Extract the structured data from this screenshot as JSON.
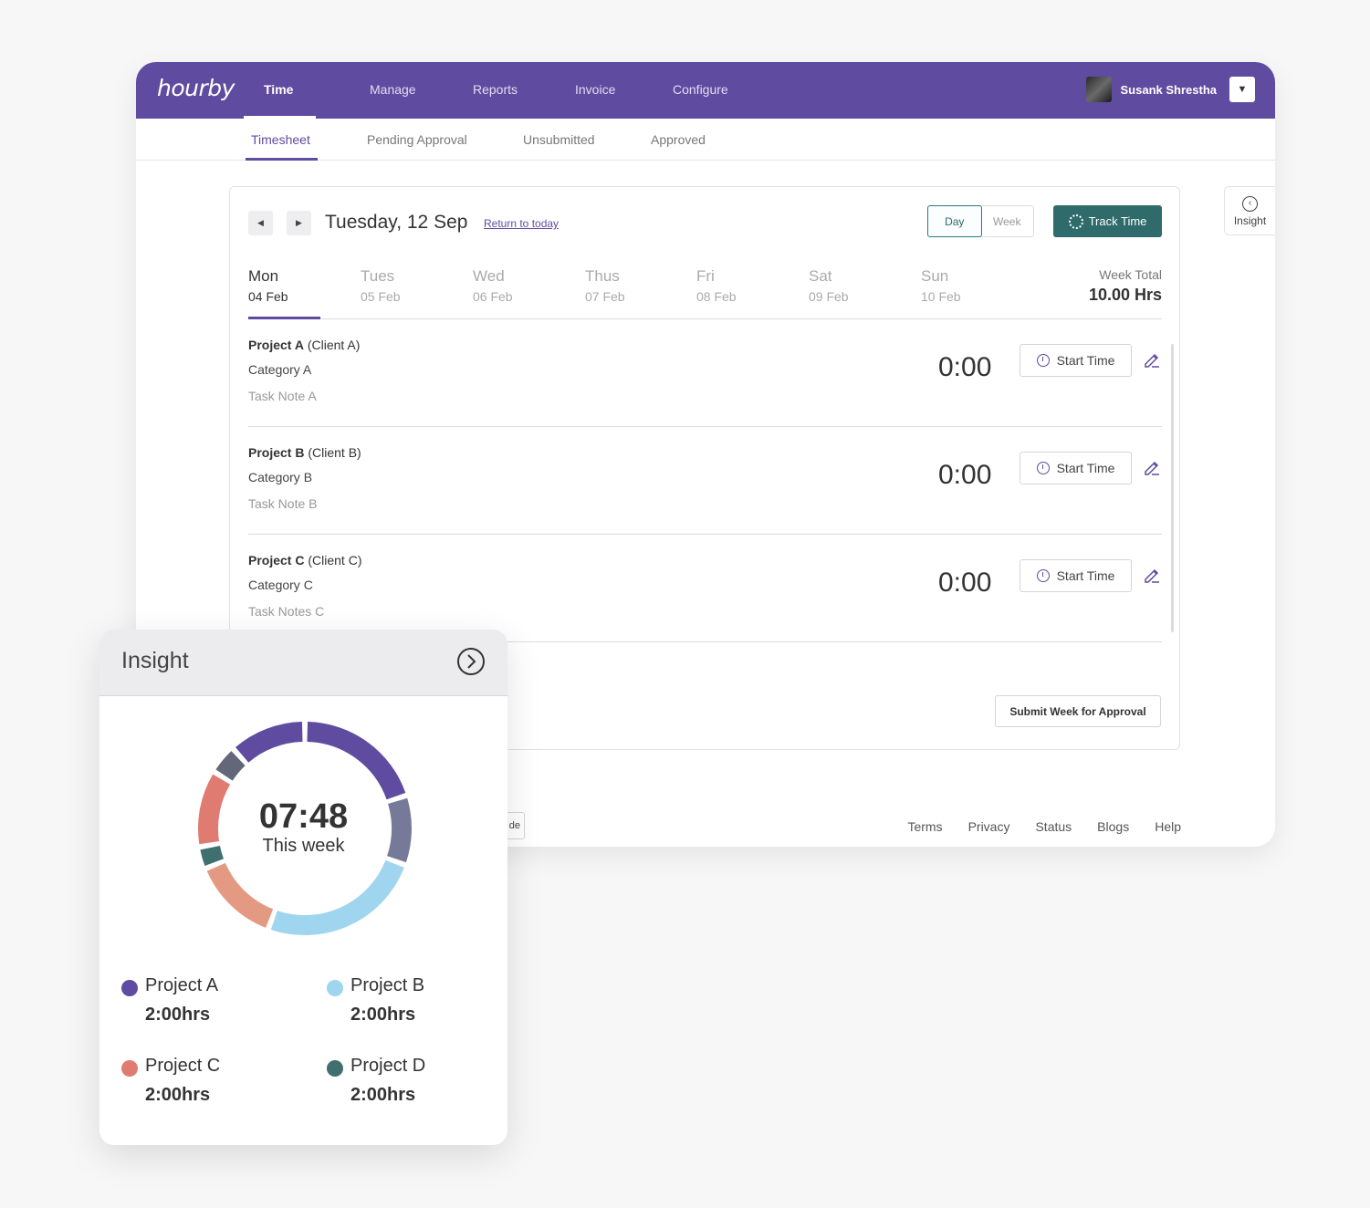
{
  "app": {
    "logo": "hourby",
    "nav": [
      "Time",
      "Manage",
      "Reports",
      "Invoice",
      "Configure"
    ],
    "user": {
      "name": "Susank Shrestha"
    },
    "tabs": [
      "Timesheet",
      "Pending Approval",
      "Unsubmitted",
      "Approved"
    ]
  },
  "timesheet": {
    "date_title": "Tuesday, 12 Sep",
    "return_link": "Return to today",
    "view_toggle": {
      "day": "Day",
      "week": "Week",
      "selected": "Day"
    },
    "track_button": "Track Time",
    "days": [
      {
        "name": "Mon",
        "date": "04 Feb"
      },
      {
        "name": "Tues",
        "date": "05 Feb"
      },
      {
        "name": "Wed",
        "date": "06 Feb"
      },
      {
        "name": "Thus",
        "date": "07 Feb"
      },
      {
        "name": "Fri",
        "date": "08 Feb"
      },
      {
        "name": "Sat",
        "date": "09 Feb"
      },
      {
        "name": "Sun",
        "date": "10 Feb"
      }
    ],
    "week_total_label": "Week Total",
    "week_total_value": "10.00 Hrs",
    "entries": [
      {
        "project": "Project A",
        "client": "(Client A)",
        "category": "Category A",
        "note": "Task Note A",
        "time": "0:00",
        "button": "Start Time"
      },
      {
        "project": "Project B",
        "client": "(Client B)",
        "category": "Category B",
        "note": "Task Note B",
        "time": "0:00",
        "button": "Start Time"
      },
      {
        "project": "Project C",
        "client": "(Client C)",
        "category": "Category C",
        "note": "Task Notes C",
        "time": "0:00",
        "button": "Start Time"
      }
    ],
    "submit_button": "Submit Week for Approval"
  },
  "footer": {
    "guide_text": "de",
    "links": [
      "Terms",
      "Privacy",
      "Status",
      "Blogs",
      "Help"
    ]
  },
  "insight_side_label": "Insight",
  "insight": {
    "title": "Insight",
    "total": "07:48",
    "total_label": "This week",
    "legend": [
      {
        "name": "Project A",
        "value": "2:00hrs",
        "color": "#5f4b9f"
      },
      {
        "name": "Project B",
        "value": "2:00hrs",
        "color": "#9fd5ee"
      },
      {
        "name": "Project C",
        "value": "2:00hrs",
        "color": "#e07b72"
      },
      {
        "name": "Project D",
        "value": "2:00hrs",
        "color": "#3f6f6e"
      }
    ]
  },
  "chart_data": {
    "type": "pie",
    "segments": [
      {
        "color": "#5f4b9f",
        "value": 72
      },
      {
        "color": "#767a98",
        "value": 38
      },
      {
        "color": "#9fd5ee",
        "value": 90
      },
      {
        "color": "#e49a82",
        "value": 48
      },
      {
        "color": "#3f6f6e",
        "value": 12
      },
      {
        "color": "#e07b72",
        "value": 42
      },
      {
        "color": "#64667a",
        "value": 16
      },
      {
        "color": "#5f4b9f",
        "value": 42
      }
    ]
  }
}
